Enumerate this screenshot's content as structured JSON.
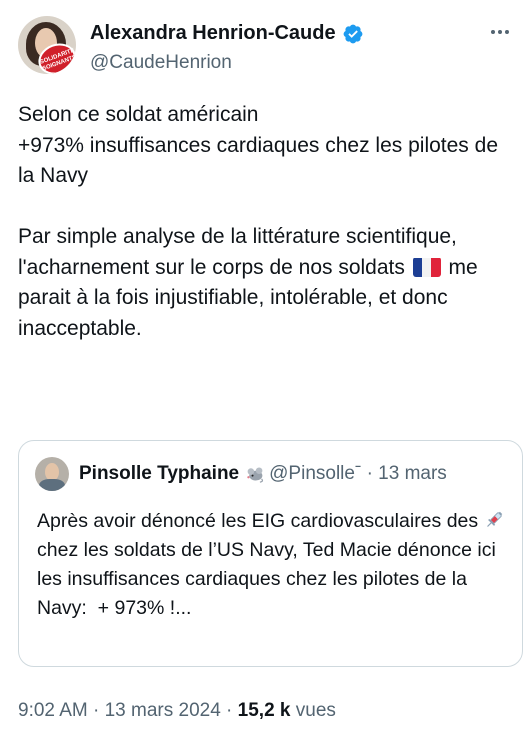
{
  "author": {
    "display_name": "Alexandra Henrion-Caude",
    "handle": "@CaudeHenrion",
    "avatar_badge_text": "SOLIDARITE SOIGNANTS"
  },
  "tweet": {
    "line1": "Selon ce soldat américain\n+973% insuffisances cardiaques chez les pilotes de la Navy\n\nPar simple analyse de la littérature scientifique, l'acharnement sur le corps de nos soldats ",
    "flag": "flag-france-icon",
    "line2": " me parait à la fois injustifiable, intolérable, et donc inacceptable."
  },
  "quote": {
    "display_name": "Pinsolle Typhaine",
    "emoji": "rat-emoji-icon",
    "handle_date": "@Pinsolleˉ · 13 mars",
    "text_part1": "Après avoir dénoncé les EIG cardiovasculaires des ",
    "syringe": "syringe-icon",
    "text_part2": " chez les soldats de l’US Navy, Ted Macie dénonce ici les insuffisances cardiaques chez les pilotes de la Navy:  + 973% !..."
  },
  "meta": {
    "time": "9:02 AM · 13 mars 2024 · ",
    "views_count": "15,2 k",
    "views_label": " vues"
  },
  "colors": {
    "verified": "#1d9bf0",
    "secondary_text": "#536471",
    "border": "#cfd9de"
  }
}
